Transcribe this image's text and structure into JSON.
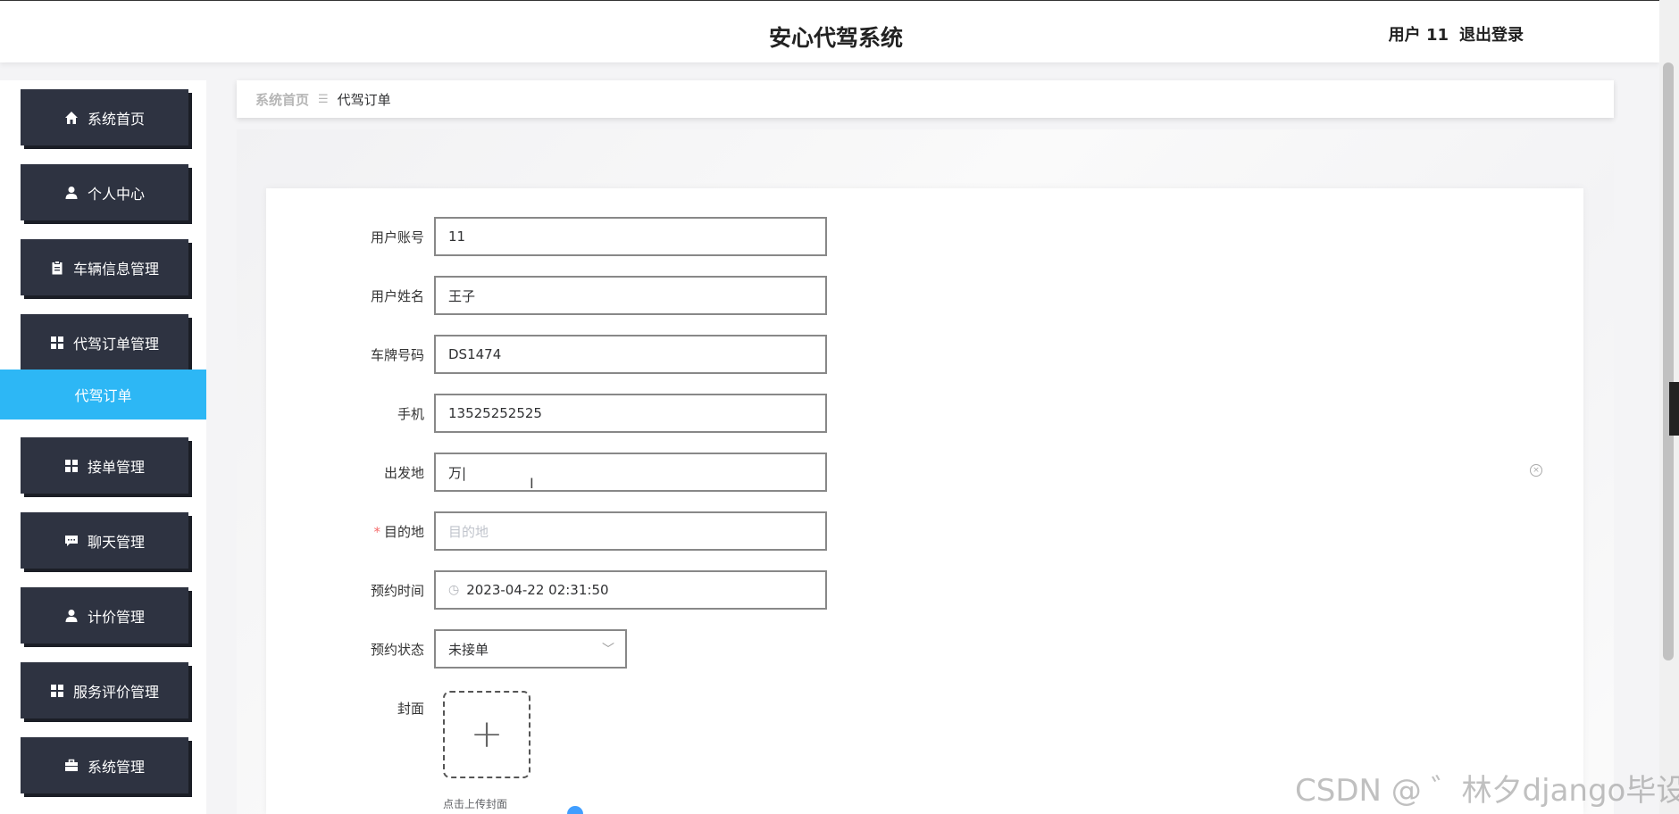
{
  "header": {
    "app_title": "安心代驾系统",
    "user_label": "用户 11",
    "logout_label": "退出登录"
  },
  "sidebar": {
    "items": [
      {
        "label": "系统首页",
        "icon": "home-icon"
      },
      {
        "label": "个人中心",
        "icon": "user-icon"
      },
      {
        "label": "车辆信息管理",
        "icon": "clipboard-icon"
      },
      {
        "label": "代驾订单管理",
        "icon": "grid-icon"
      },
      {
        "label": "接单管理",
        "icon": "grid-icon"
      },
      {
        "label": "聊天管理",
        "icon": "chat-icon"
      },
      {
        "label": "计价管理",
        "icon": "user-icon"
      },
      {
        "label": "服务评价管理",
        "icon": "grid-icon"
      },
      {
        "label": "系统管理",
        "icon": "briefcase-icon"
      }
    ],
    "active_sub_item": "代驾订单",
    "active_color": "#2db7f5"
  },
  "breadcrumb": {
    "home": "系统首页",
    "current": "代驾订单"
  },
  "form": {
    "fields": [
      {
        "label": "用户账号",
        "value": "11"
      },
      {
        "label": "用户姓名",
        "value": "王子"
      },
      {
        "label": "车牌号码",
        "value": "DS1474"
      },
      {
        "label": "手机",
        "value": "13525252525"
      },
      {
        "label": "出发地",
        "value": "万|"
      },
      {
        "label": "目的地",
        "value": "",
        "placeholder": "目的地",
        "required": true
      },
      {
        "label": "预约时间",
        "value": "2023-04-22 02:31:50",
        "icon": "clock-icon"
      },
      {
        "label": "预约状态",
        "value": "未接单",
        "icon": "chevron-down-icon"
      }
    ],
    "cover_label": "封面",
    "upload_tip": "点击上传封面"
  },
  "watermark": "CSDN @ ゛林夕django毕设"
}
